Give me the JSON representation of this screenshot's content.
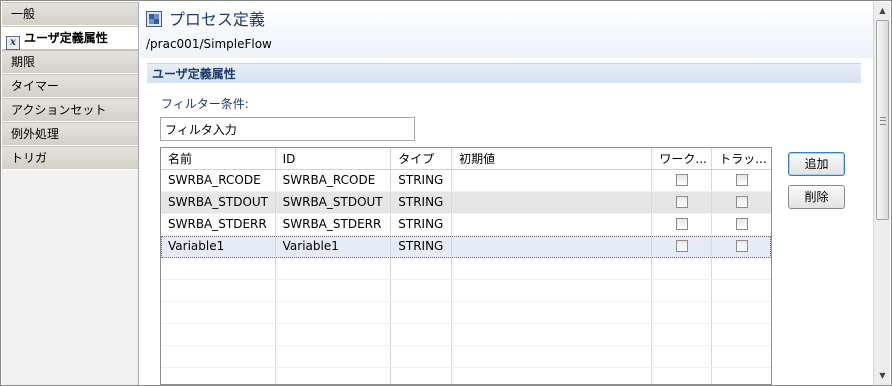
{
  "sidebar": {
    "items": [
      {
        "label": "一般",
        "selected": false
      },
      {
        "label": "ユーザ定義属性",
        "selected": true,
        "icon": "variable-icon"
      },
      {
        "label": "期限",
        "selected": false
      },
      {
        "label": "タイマー",
        "selected": false
      },
      {
        "label": "アクションセット",
        "selected": false
      },
      {
        "label": "例外処理",
        "selected": false
      },
      {
        "label": "トリガ",
        "selected": false
      }
    ]
  },
  "header": {
    "title": "プロセス定義",
    "title_icon": "process-definition-icon",
    "path": "/prac001/SimpleFlow"
  },
  "section": {
    "title": "ユーザ定義属性",
    "filter_label": "フィルター条件:",
    "filter_value": "フィルタ入力"
  },
  "table": {
    "columns": [
      "名前",
      "ID",
      "タイプ",
      "初期値",
      "ワーク...",
      "トラッ..."
    ],
    "rows": [
      {
        "name": "SWRBA_RCODE",
        "id": "SWRBA_RCODE",
        "type": "STRING",
        "initial": "",
        "work": false,
        "track": false
      },
      {
        "name": "SWRBA_STDOUT",
        "id": "SWRBA_STDOUT",
        "type": "STRING",
        "initial": "",
        "work": false,
        "track": false
      },
      {
        "name": "SWRBA_STDERR",
        "id": "SWRBA_STDERR",
        "type": "STRING",
        "initial": "",
        "work": false,
        "track": false
      },
      {
        "name": "Variable1",
        "id": "Variable1",
        "type": "STRING",
        "initial": "",
        "work": false,
        "track": false
      }
    ]
  },
  "buttons": {
    "add_label": "追加",
    "delete_label": "削除"
  },
  "colors": {
    "title": "#1d3c72",
    "section_bar": "#d7e2f1",
    "selected_row": "#e4ecf8",
    "alt_row": "#e6e6e6"
  }
}
